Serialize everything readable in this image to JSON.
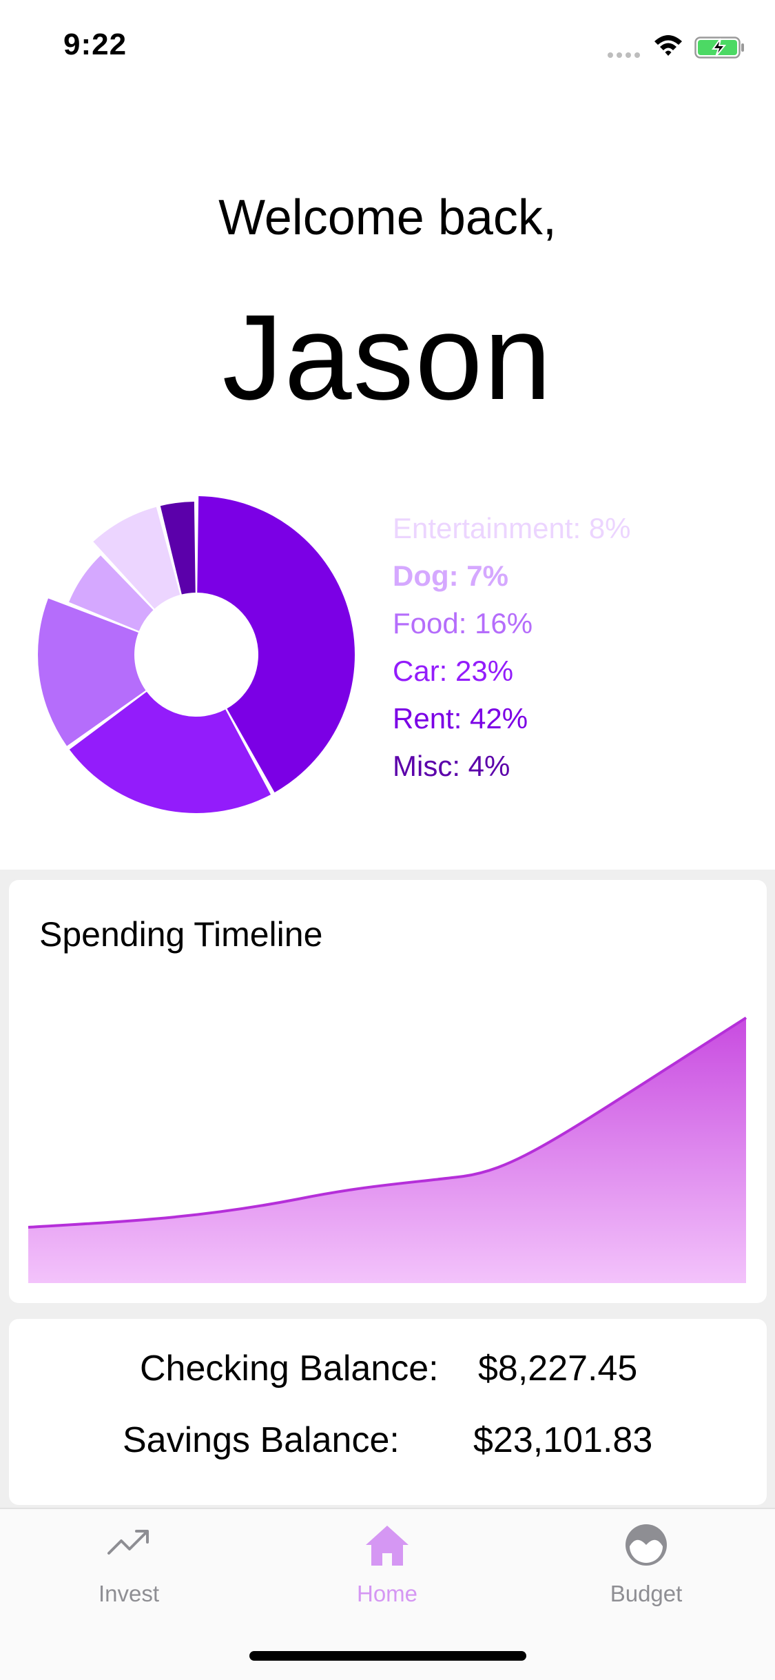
{
  "status_bar": {
    "time": "9:22",
    "battery_color": "#4cd964"
  },
  "header": {
    "welcome": "Welcome back,",
    "name": "Jason"
  },
  "spending_breakdown": {
    "items": [
      {
        "label": "Entertainment: 8%",
        "category": "Entertainment",
        "percent": 8,
        "color": "#ecd5ff"
      },
      {
        "label": "Dog: 7%",
        "category": "Dog",
        "percent": 7,
        "color": "#d5a8ff",
        "bold": true
      },
      {
        "label": "Food: 16%",
        "category": "Food",
        "percent": 16,
        "color": "#b56dfb"
      },
      {
        "label": "Car: 23%",
        "category": "Car",
        "percent": 23,
        "color": "#931cfb"
      },
      {
        "label": "Rent: 42%",
        "category": "Rent",
        "percent": 42,
        "color": "#7b00e5"
      },
      {
        "label": "Misc: 4%",
        "category": "Misc",
        "percent": 4,
        "color": "#5b00aa"
      }
    ]
  },
  "timeline": {
    "title": "Spending Timeline",
    "line_color": "#b52fd9",
    "fill_top": "#c84be0",
    "fill_bottom": "#f3c3fb"
  },
  "balances": {
    "checking_label": "Checking Balance:",
    "checking_value": "$8,227.45",
    "savings_label": "Savings Balance:",
    "savings_value": "$23,101.83"
  },
  "tab_bar": {
    "tabs": [
      {
        "label": "Invest",
        "icon": "trending-up-icon",
        "active": false
      },
      {
        "label": "Home",
        "icon": "house-icon",
        "active": true
      },
      {
        "label": "Budget",
        "icon": "gauge-icon",
        "active": false
      }
    ],
    "active_color": "#d597f3",
    "inactive_color": "#8e8e93"
  }
}
